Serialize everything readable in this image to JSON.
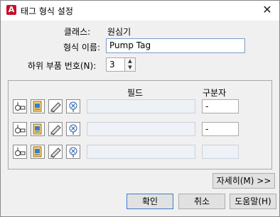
{
  "window": {
    "title": "태그 형식 설정",
    "accent": "#c8102e"
  },
  "form": {
    "class_label": "클래스:",
    "class_value": "원심기",
    "name_label": "형식 이름:",
    "name_value": "Pump Tag",
    "sub_label": "하위 부품 번호(N):",
    "sub_value": "3"
  },
  "fields": {
    "field_header": "필드",
    "sep_header": "구분자",
    "rows": [
      {
        "field": "",
        "separator": "-"
      },
      {
        "field": "",
        "separator": "-"
      },
      {
        "field": "",
        "separator": ""
      }
    ]
  },
  "buttons": {
    "details": "자세히(M) >>",
    "ok": "확인",
    "cancel": "취소",
    "help": "도움말(H)"
  }
}
